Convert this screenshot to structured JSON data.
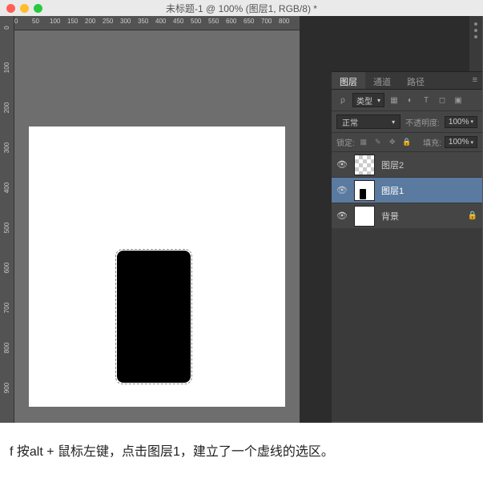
{
  "title": "未标题-1 @ 100% (图层1, RGB/8) *",
  "hruler_ticks": [
    {
      "p": 0,
      "v": "0"
    },
    {
      "p": 22,
      "v": "50"
    },
    {
      "p": 44,
      "v": "100"
    },
    {
      "p": 66,
      "v": "150"
    },
    {
      "p": 88,
      "v": "200"
    },
    {
      "p": 110,
      "v": "250"
    },
    {
      "p": 132,
      "v": "300"
    },
    {
      "p": 154,
      "v": "350"
    },
    {
      "p": 176,
      "v": "400"
    },
    {
      "p": 198,
      "v": "450"
    },
    {
      "p": 220,
      "v": "500"
    },
    {
      "p": 242,
      "v": "550"
    },
    {
      "p": 264,
      "v": "600"
    },
    {
      "p": 286,
      "v": "650"
    },
    {
      "p": 308,
      "v": "700"
    },
    {
      "p": 330,
      "v": "800"
    }
  ],
  "vruler_ticks": [
    {
      "p": 10,
      "v": "0"
    },
    {
      "p": 60,
      "v": "100"
    },
    {
      "p": 110,
      "v": "200"
    },
    {
      "p": 160,
      "v": "300"
    },
    {
      "p": 210,
      "v": "400"
    },
    {
      "p": 260,
      "v": "500"
    },
    {
      "p": 310,
      "v": "600"
    },
    {
      "p": 360,
      "v": "700"
    },
    {
      "p": 410,
      "v": "800"
    },
    {
      "p": 460,
      "v": "900"
    }
  ],
  "panel": {
    "tabs": {
      "layers": "图层",
      "channels": "通道",
      "paths": "路径"
    },
    "filter_label": "类型",
    "blend_mode": "正常",
    "opacity_label": "不透明度:",
    "opacity_value": "100%",
    "lock_label": "锁定:",
    "fill_label": "填充:",
    "fill_value": "100%",
    "layers": [
      {
        "name": "图层2"
      },
      {
        "name": "图层1"
      },
      {
        "name": "背景"
      }
    ]
  },
  "caption": "f 按alt + 鼠标左键，点击图层1，建立了一个虚线的选区。"
}
